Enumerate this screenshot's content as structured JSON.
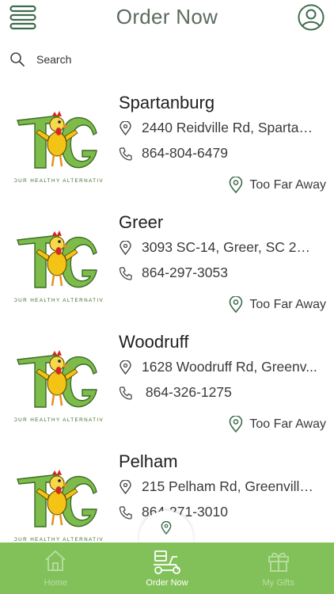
{
  "header": {
    "title": "Order Now"
  },
  "search": {
    "placeholder": "Search"
  },
  "stores": [
    {
      "name": "Spartanburg",
      "address": "2440 Reidville Rd, Spartan...",
      "phone": "864-804-6479",
      "distance": "Too Far Away"
    },
    {
      "name": "Greer",
      "address": "3093 SC-14, Greer, SC 296...",
      "phone": "864-297-3053",
      "distance": "Too Far Away"
    },
    {
      "name": "Woodruff",
      "address": "1628 Woodruff Rd, Greenv...",
      "phone": " 864-326-1275",
      "distance": "Too Far Away"
    },
    {
      "name": "Pelham",
      "address": "215 Pelham Rd, Greenville,...",
      "phone": "864-271-3010",
      "distance": ""
    }
  ],
  "logo": {
    "tagline": "YOUR HEALTHY ALTERNATIVE",
    "letters": "TG"
  },
  "tabs": [
    {
      "label": "Home"
    },
    {
      "label": "Order Now"
    },
    {
      "label": "My Gifts"
    }
  ],
  "colors": {
    "accent": "#82c15a",
    "icon": "#3e6b4c"
  }
}
